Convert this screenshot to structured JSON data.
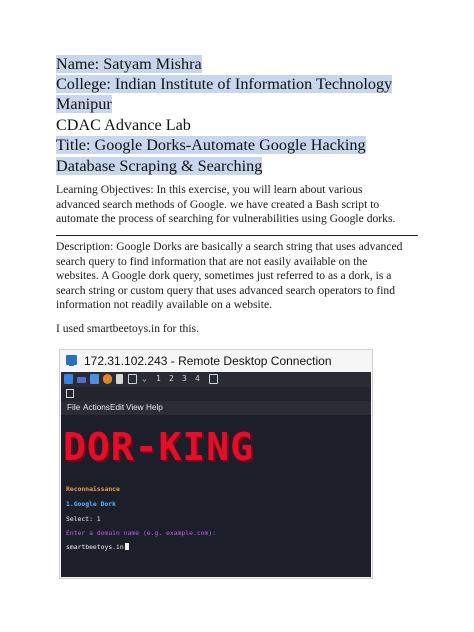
{
  "header": {
    "name": "Name: Satyam Mishra",
    "college_line1": "College: Indian Institute of Information Technology",
    "college_line2": "Manipur",
    "lab": "CDAC Advance Lab",
    "title_line1": "Title: Google Dorks-Automate Google Hacking",
    "title_line2": "Database Scraping & Searching"
  },
  "objectives": {
    "line1": "Learning Objectives: In this exercise, you will learn about various",
    "line2": "advanced search methods of Google. we have created a Bash script to",
    "line3": "automate the process of searching for vulnerabilities using Google dorks."
  },
  "description": {
    "line1": "Description: Google Dorks are basically a search string that uses advanced",
    "line2": "search query to find information that are not easily available on the",
    "line3": "websites. A Google dork query, sometimes just referred to as a dork, is a",
    "line4": "search string or custom query that uses advanced search operators to find",
    "line5": "information not readily available on a website."
  },
  "note": "I used smartbeetoys.in for this.",
  "screenshot": {
    "window_title": "172.31.102.243 - Remote Desktop Connection",
    "workspaces": [
      "1",
      "2",
      "3",
      "4"
    ],
    "menu": [
      "File",
      "Actions",
      "Edit",
      "View",
      "Help"
    ],
    "banner": "DOR-KING",
    "lines": {
      "section": "Reconnaissance",
      "option": "1.Google Dork",
      "select": "Select:  1",
      "prompt": "Enter a domain name (e.g. example.com):",
      "input": "smartbeetoys.in"
    },
    "colors": {
      "terminal_bg": "#1c1e2a",
      "banner": "#e0102a",
      "section": "#f0a23a",
      "option": "#5fb6ff",
      "prompt": "#b464e6"
    }
  }
}
